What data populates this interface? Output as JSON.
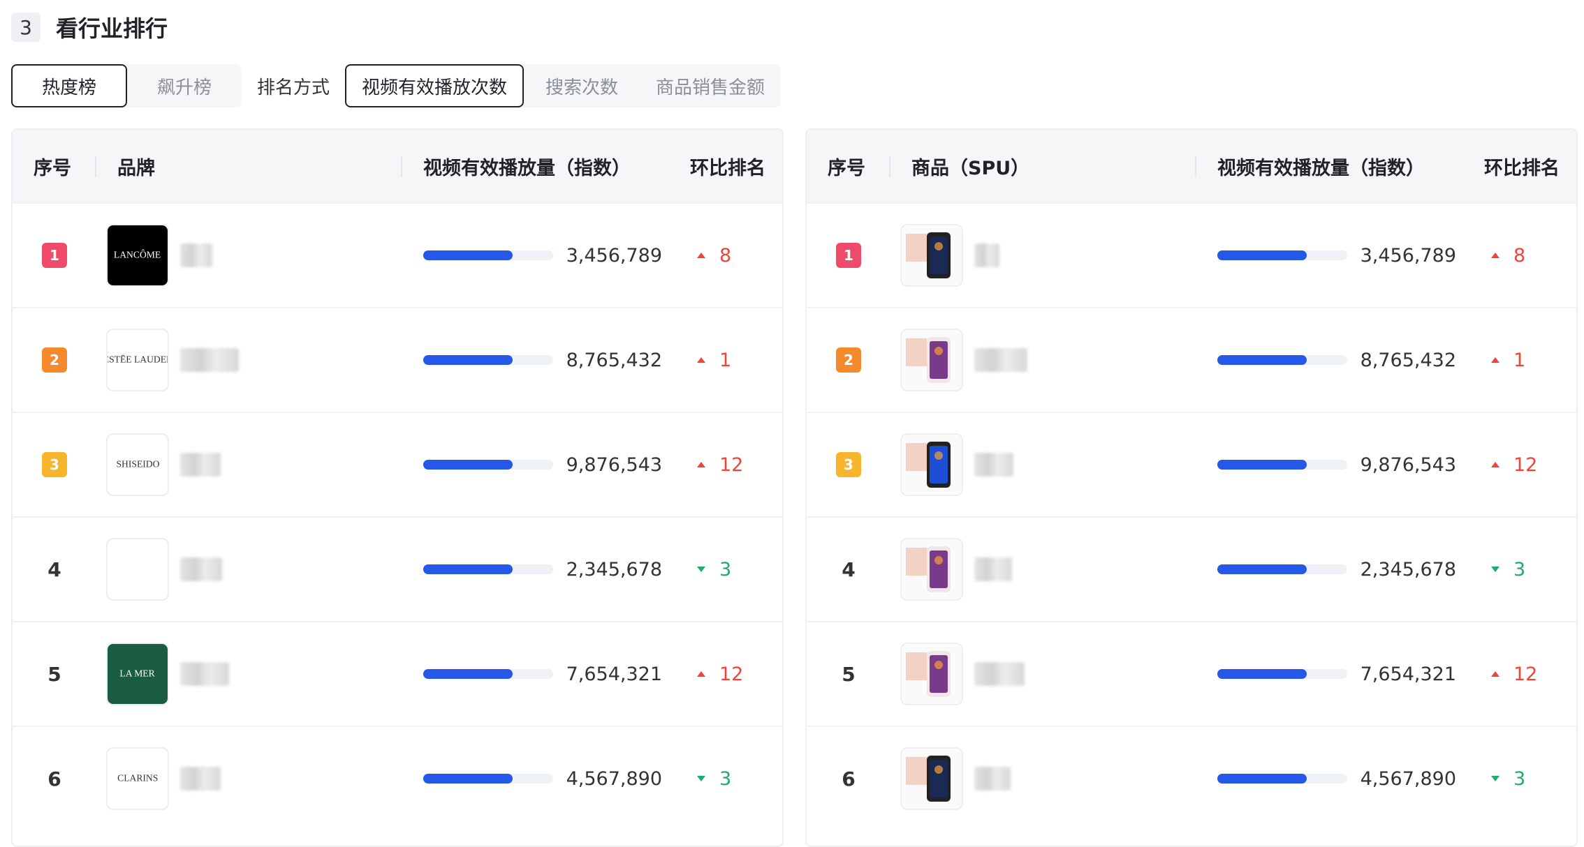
{
  "section": {
    "number": "3",
    "title": "看行业排行"
  },
  "tabs": [
    {
      "label": "热度榜",
      "active": true
    },
    {
      "label": "飙升榜",
      "active": false
    }
  ],
  "sort": {
    "label": "排名方式",
    "options": [
      {
        "label": "视频有效播放次数",
        "active": true
      },
      {
        "label": "搜索次数",
        "active": false
      },
      {
        "label": "商品销售金额",
        "active": false
      }
    ]
  },
  "colors": {
    "accent_bar": "#2558e8",
    "up": "#f0443b",
    "down": "#1fab6a",
    "rank1": "#f04a6a",
    "rank2": "#f58a2c",
    "rank3": "#f7b52b"
  },
  "brand_table": {
    "headers": [
      "序号",
      "品牌",
      "视频有效播放量（指数）",
      "环比排名"
    ],
    "rows": [
      {
        "rank": "1",
        "logo_text": "LANCÔME",
        "logo_icon": "brand-logo-black",
        "value": "3,456,789",
        "bar_fraction": 0.69,
        "trend": "up",
        "change": "8"
      },
      {
        "rank": "2",
        "logo_text": "ESTĒE LAUDER",
        "logo_icon": "brand-logo-white",
        "value": "8,765,432",
        "bar_fraction": 0.69,
        "trend": "up",
        "change": "1"
      },
      {
        "rank": "3",
        "logo_text": "SHISEIDO",
        "logo_icon": "brand-logo-white",
        "value": "9,876,543",
        "bar_fraction": 0.69,
        "trend": "up",
        "change": "12"
      },
      {
        "rank": "4",
        "logo_text": "",
        "logo_icon": "brand-logo-white",
        "value": "2,345,678",
        "bar_fraction": 0.69,
        "trend": "down",
        "change": "3"
      },
      {
        "rank": "5",
        "logo_text": "LA MER",
        "logo_icon": "brand-logo-green",
        "value": "7,654,321",
        "bar_fraction": 0.69,
        "trend": "up",
        "change": "12"
      },
      {
        "rank": "6",
        "logo_text": "CLARINS",
        "logo_icon": "brand-logo-white",
        "value": "4,567,890",
        "bar_fraction": 0.69,
        "trend": "down",
        "change": "3"
      }
    ]
  },
  "product_table": {
    "headers": [
      "序号",
      "商品（SPU）",
      "视频有效播放量（指数）",
      "环比排名"
    ],
    "rows": [
      {
        "rank": "1",
        "thumb_icon": "phone-thumbnail-dark",
        "value": "3,456,789",
        "bar_fraction": 0.69,
        "trend": "up",
        "change": "8"
      },
      {
        "rank": "2",
        "thumb_icon": "phone-thumbnail-purple",
        "value": "8,765,432",
        "bar_fraction": 0.69,
        "trend": "up",
        "change": "1"
      },
      {
        "rank": "3",
        "thumb_icon": "phone-thumbnail-blue",
        "value": "9,876,543",
        "bar_fraction": 0.69,
        "trend": "up",
        "change": "12"
      },
      {
        "rank": "4",
        "thumb_icon": "phone-thumbnail-purple",
        "value": "2,345,678",
        "bar_fraction": 0.69,
        "trend": "down",
        "change": "3"
      },
      {
        "rank": "5",
        "thumb_icon": "phone-thumbnail-purple",
        "value": "7,654,321",
        "bar_fraction": 0.69,
        "trend": "up",
        "change": "12"
      },
      {
        "rank": "6",
        "thumb_icon": "phone-thumbnail-dark",
        "value": "4,567,890",
        "bar_fraction": 0.69,
        "trend": "down",
        "change": "3"
      }
    ]
  }
}
